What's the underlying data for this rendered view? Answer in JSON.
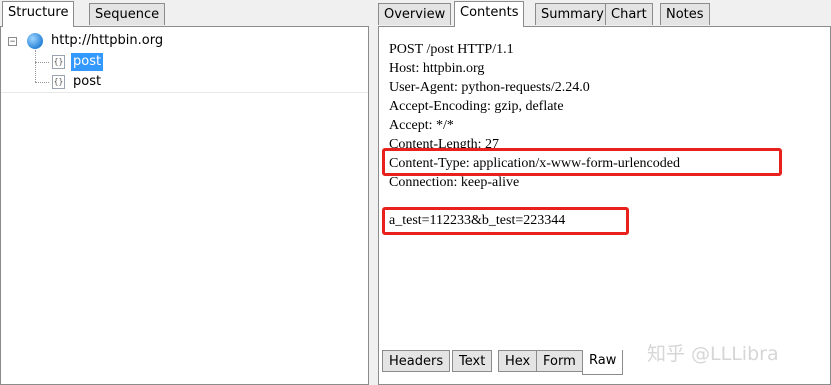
{
  "left_panel": {
    "tabs": [
      {
        "label": "Structure",
        "active": true
      },
      {
        "label": "Sequence",
        "active": false
      }
    ],
    "tree": {
      "host": {
        "label": "http://httpbin.org",
        "icon": "globe-icon",
        "expander": "−"
      },
      "children": [
        {
          "label": "post",
          "icon": "request-icon",
          "icon_glyph": "{}",
          "selected": true
        },
        {
          "label": "post",
          "icon": "request-icon",
          "icon_glyph": "{}",
          "selected": false
        }
      ]
    }
  },
  "right_panel": {
    "tabs": [
      {
        "label": "Overview",
        "active": false
      },
      {
        "label": "Contents",
        "active": true
      },
      {
        "label": "Summary",
        "active": false
      },
      {
        "label": "Chart",
        "active": false
      },
      {
        "label": "Notes",
        "active": false
      }
    ],
    "request_lines": [
      "POST /post HTTP/1.1",
      "Host: httpbin.org",
      "User-Agent: python-requests/2.24.0",
      "Accept-Encoding: gzip, deflate",
      "Accept: */*",
      "Content-Length: 27",
      "Content-Type: application/x-www-form-urlencoded",
      "Connection: keep-alive",
      "",
      "a_test=112233&b_test=223344"
    ],
    "bottom_tabs": [
      {
        "label": "Headers",
        "active": false
      },
      {
        "label": "Text",
        "active": false
      },
      {
        "label": "Hex",
        "active": false
      },
      {
        "label": "Form",
        "active": false
      },
      {
        "label": "Raw",
        "active": true
      }
    ],
    "highlight_color": "#e8211d"
  },
  "watermark": "知乎 @LLLibra"
}
